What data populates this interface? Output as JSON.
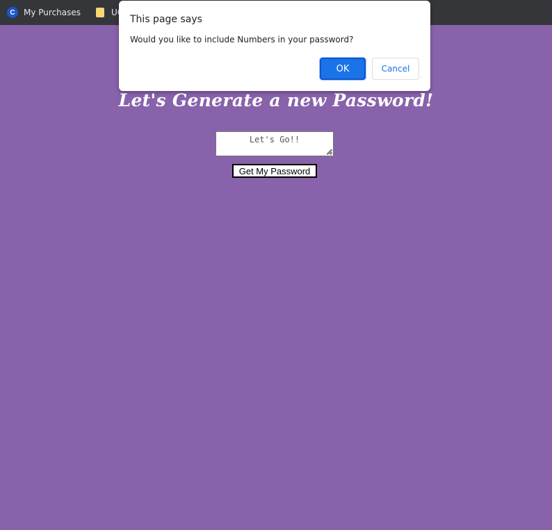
{
  "bookmarks": [
    {
      "label": "My Purchases",
      "icon": "c-logo-icon"
    },
    {
      "label": "UCD",
      "icon": "folder-icon"
    }
  ],
  "page": {
    "title": "Let's Generate a new Password!",
    "password_box_value": "Let's Go!!",
    "generate_button_label": "Get My Password",
    "background_color": "#8862ab"
  },
  "dialog": {
    "title": "This page says",
    "message": "Would you like to include Numbers in your password?",
    "ok_label": "OK",
    "cancel_label": "Cancel"
  }
}
